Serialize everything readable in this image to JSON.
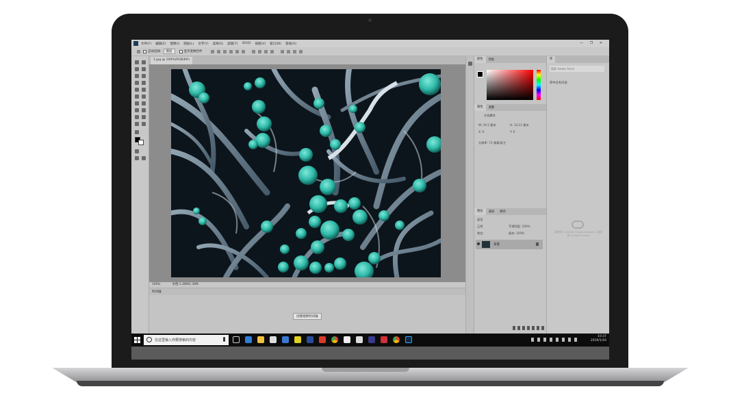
{
  "ps": {
    "menu": [
      "文件(F)",
      "编辑(E)",
      "图像(I)",
      "图层(L)",
      "文字(Y)",
      "选择(S)",
      "滤镜(T)",
      "3D(D)",
      "视图(V)",
      "窗口(W)",
      "帮助(H)"
    ],
    "window_controls": "— ❐ ✕",
    "options": {
      "auto_select": "自动选择:",
      "auto_select_value": "图层",
      "show_transform": "显示变换控件"
    },
    "doc_tab": "1.jpg @ 100%(RGB/8#)",
    "status": {
      "zoom": "100%",
      "doc_size": "文档:1.30M/1.30M"
    },
    "timeline": {
      "title": "时间轴",
      "create_button": "创建视频时间轴"
    },
    "panels": {
      "color_tabs": [
        "颜色",
        "色板"
      ],
      "props_tabs": [
        "属性",
        "调整"
      ],
      "props": {
        "title": "文档属性",
        "w": "W: 19.5 厘米",
        "h": "H: 14.11 厘米",
        "x": "X: 0",
        "y": "Y: 0",
        "resolution": "分辨率: 72 像素/英寸"
      },
      "layer_tabs": [
        "图层",
        "通道",
        "路径"
      ],
      "layer_kind": "类型",
      "blend_mode": "正常",
      "opacity": "不透明度: 100%",
      "lock": "锁定:",
      "fill": "填充: 100%",
      "layer_name": "背景",
      "lib_tab": "库",
      "lib_search": "搜索 Adobe Stock",
      "lib_empty": "库中没有内容",
      "cc_text": "要使用 Creative Cloud Libraries，请安装 Creative Cloud"
    }
  },
  "taskbar": {
    "search_placeholder": "在这里输入你要搜索的内容",
    "time": "10:37",
    "date": "2019/1/16"
  },
  "colors": {
    "taskbar": "#0c0c0c",
    "ps_panel": "#c5c5c5",
    "teal": "#2fb9a8"
  }
}
